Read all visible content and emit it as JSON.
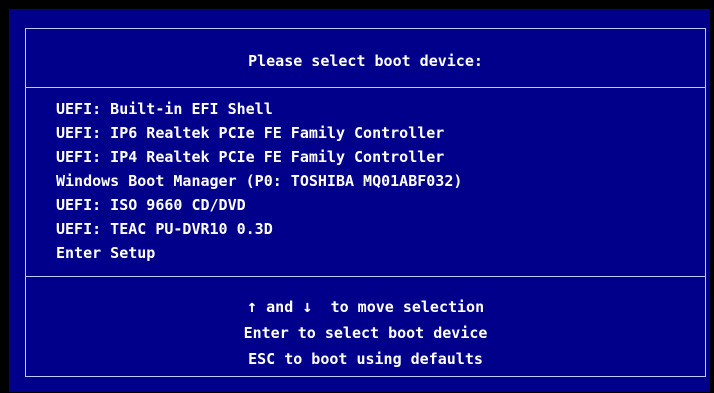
{
  "boot_menu": {
    "title": "Please select boot device:",
    "devices": [
      "UEFI: Built-in EFI Shell",
      "UEFI: IP6 Realtek PCIe FE Family Controller",
      "UEFI: IP4 Realtek PCIe FE Family Controller",
      "Windows Boot Manager (P0: TOSHIBA MQ01ABF032)",
      "UEFI: ISO 9660 CD/DVD",
      "UEFI: TEAC PU-DVR10 0.3D",
      "Enter Setup"
    ],
    "help": {
      "up_arrow_icon": "arrow-up-icon",
      "up_arrow_glyph": "↑",
      "and_text": " and ",
      "down_arrow_icon": "arrow-down-icon",
      "down_arrow_glyph": "↓",
      "move_text": "  to move selection",
      "select_text": "Enter to select boot device",
      "defaults_text": "ESC to boot using defaults"
    }
  },
  "colors": {
    "background": "#00008b",
    "outer": "#000000",
    "text": "#ffffff",
    "border": "#c0c8ff"
  }
}
